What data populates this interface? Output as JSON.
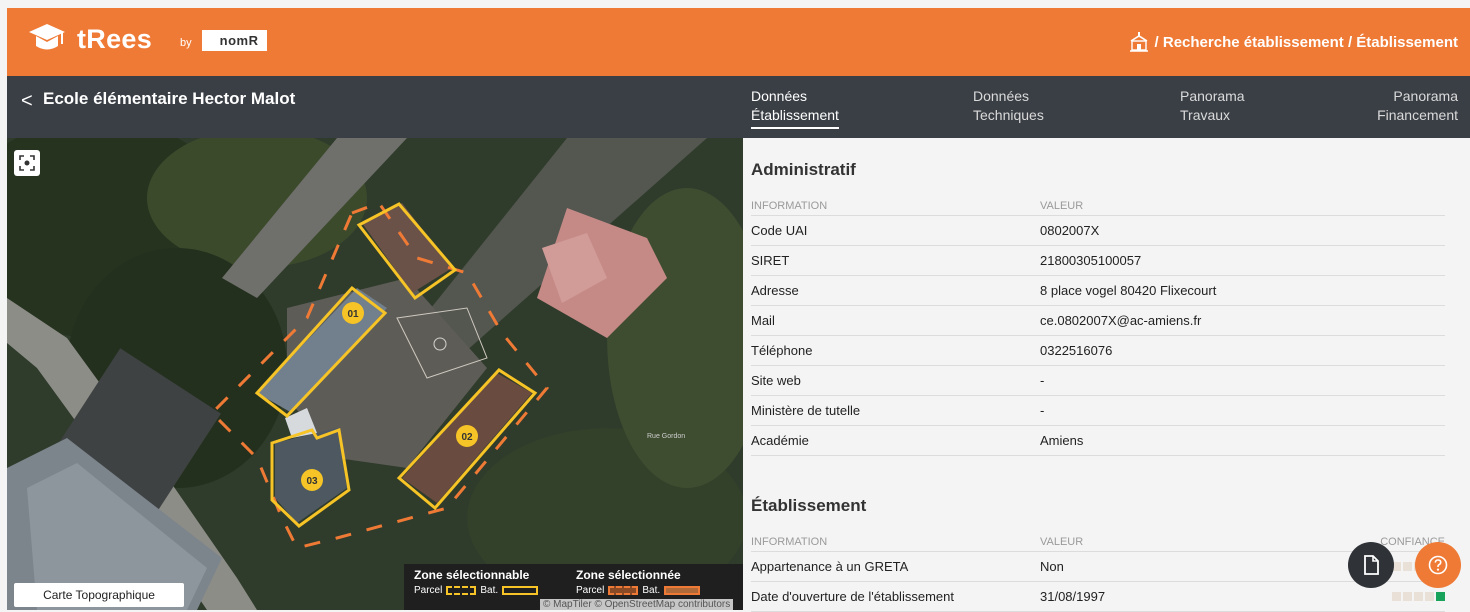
{
  "header": {
    "brand": "tRees",
    "by": "by",
    "partner": "nomR",
    "breadcrumb": "/ Recherche établissement / Établissement",
    "icons": {
      "brand": "graduation-cap-icon",
      "home": "school-home-icon"
    }
  },
  "titlebar": {
    "back": "<",
    "title": "Ecole élémentaire Hector Malot",
    "tabs": [
      {
        "line1": "Données",
        "line2": "Établissement",
        "active": true
      },
      {
        "line1": "Données",
        "line2": "Techniques",
        "active": false
      },
      {
        "line1": "Panorama",
        "line2": "Travaux",
        "active": false
      },
      {
        "line1": "Panorama",
        "line2": "Financement",
        "active": false
      }
    ]
  },
  "map": {
    "topo_button": "Carte Topographique",
    "markers": [
      "01",
      "02",
      "03"
    ],
    "street_label": "Rue Gordon",
    "legend": {
      "selectable": {
        "title": "Zone sélectionnable",
        "parcel": "Parcel",
        "bat": "Bat."
      },
      "selected": {
        "title": "Zone sélectionnée",
        "parcel": "Parcel",
        "bat": "Bat."
      }
    },
    "attribution": "© MapTiler © OpenStreetMap contributors"
  },
  "administratif": {
    "title": "Administratif",
    "headers": [
      "INFORMATION",
      "VALEUR"
    ],
    "rows": [
      {
        "label": "Code UAI",
        "value": "0802007X"
      },
      {
        "label": "SIRET",
        "value": "21800305100057"
      },
      {
        "label": "Adresse",
        "value": "8 place vogel 80420 Flixecourt"
      },
      {
        "label": "Mail",
        "value": "ce.0802007X@ac-amiens.fr"
      },
      {
        "label": "Téléphone",
        "value": "0322516076"
      },
      {
        "label": "Site web",
        "value": "-"
      },
      {
        "label": "Ministère de tutelle",
        "value": "-"
      },
      {
        "label": "Académie",
        "value": "Amiens"
      }
    ]
  },
  "etablissement": {
    "title": "Établissement",
    "headers": [
      "INFORMATION",
      "VALEUR",
      "CONFIANCE"
    ],
    "rows": [
      {
        "label": "Appartenance à un GRETA",
        "value": "Non",
        "confidence": 5
      },
      {
        "label": "Date d'ouverture de l'établissement",
        "value": "31/08/1997",
        "confidence": 5
      }
    ]
  },
  "colors": {
    "accent": "#ef7a35",
    "dark": "#3a3f45",
    "confidence_on": "#19a35a"
  }
}
